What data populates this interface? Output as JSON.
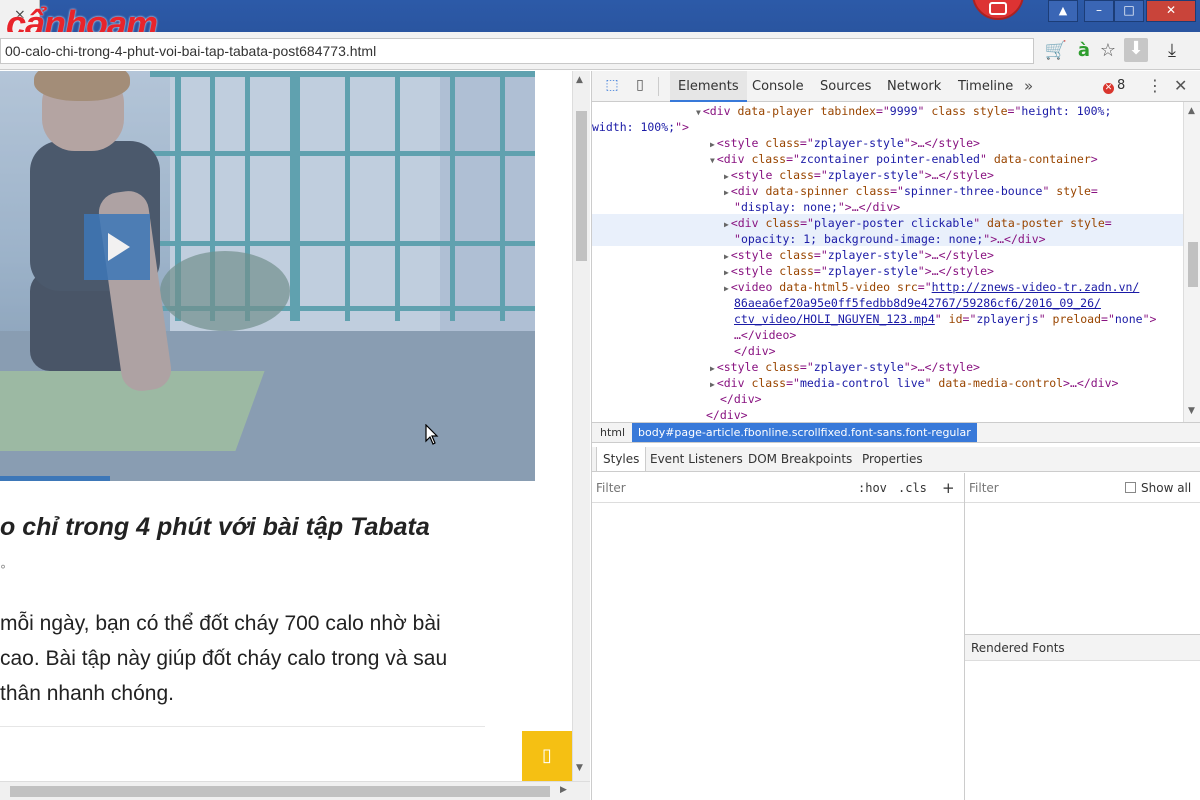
{
  "browser": {
    "tab_close": "×",
    "logo_text": "cẩnhoam",
    "url": "00-calo-chi-trong-4-phut-voi-bai-tap-tabata-post684773.html",
    "window": {
      "minimize": "–",
      "maximize": "□",
      "close": "✕",
      "user": "👤"
    },
    "toolbar": {
      "cart": "🛒",
      "a": "à",
      "star": "☆",
      "download_active": "⬇",
      "download": "⤓"
    }
  },
  "page": {
    "headline": "o chỉ trong 4 phút với bài tập Tabata",
    "degree": "°",
    "paragraph": [
      " mỗi ngày, bạn có thể đốt cháy 700 calo nhờ bài",
      "cao. Bài tập này giúp đốt cháy calo trong và sau",
      " thân nhanh chóng."
    ],
    "yellow_icon": "▯"
  },
  "devtools": {
    "tabs": [
      {
        "label": "Elements",
        "active": true
      },
      {
        "label": "Console"
      },
      {
        "label": "Sources"
      },
      {
        "label": "Network"
      },
      {
        "label": "Timeline"
      }
    ],
    "more": "»",
    "error_count": "8",
    "error_dot": "✕",
    "kebab": "⋮",
    "close": "✕",
    "breadcrumbs": [
      {
        "label": "html"
      },
      {
        "label": "body#page-article.fbonline.scrollfixed.font-sans.font-regular",
        "selected": true
      }
    ],
    "subtabs": [
      {
        "label": "Styles",
        "active": true
      },
      {
        "label": "Event Listeners"
      },
      {
        "label": "DOM Breakpoints"
      },
      {
        "label": "Properties"
      }
    ],
    "filter_placeholder": "Filter",
    "hov": ":hov",
    "cls": ".cls",
    "plus": "+",
    "right_filter_placeholder": "Filter",
    "show_all": "Show all",
    "rendered_fonts": "Rendered Fonts"
  },
  "dom_lines": [
    {
      "indent": 104,
      "tri": "▼",
      "parts": [
        [
          "tag",
          "<div "
        ],
        [
          "attr",
          "data-player "
        ],
        [
          "attr",
          "tabindex"
        ],
        [
          "tag",
          "=\""
        ],
        [
          "val",
          "9999"
        ],
        [
          "tag",
          "\" "
        ],
        [
          "attr",
          "class "
        ],
        [
          "attr",
          "style"
        ],
        [
          "tag",
          "=\""
        ],
        [
          "val",
          "height: 100%;"
        ]
      ]
    },
    {
      "indent": 104,
      "tri": "",
      "parts": [
        [
          "val",
          "width: 100%;"
        ],
        [
          "tag",
          "\">"
        ]
      ]
    },
    {
      "indent": 118,
      "tri": "▶",
      "parts": [
        [
          "tag",
          "<style "
        ],
        [
          "attr",
          "class"
        ],
        [
          "tag",
          "=\""
        ],
        [
          "val",
          "zplayer-style"
        ],
        [
          "tag",
          "\">…</style>"
        ]
      ]
    },
    {
      "indent": 118,
      "tri": "▼",
      "parts": [
        [
          "tag",
          "<div "
        ],
        [
          "attr",
          "class"
        ],
        [
          "tag",
          "=\""
        ],
        [
          "val",
          "zcontainer pointer-enabled"
        ],
        [
          "tag",
          "\" "
        ],
        [
          "attr",
          "data-container"
        ],
        [
          "tag",
          ">"
        ]
      ]
    },
    {
      "indent": 132,
      "tri": "▶",
      "parts": [
        [
          "tag",
          "<style "
        ],
        [
          "attr",
          "class"
        ],
        [
          "tag",
          "=\""
        ],
        [
          "val",
          "zplayer-style"
        ],
        [
          "tag",
          "\">…</style>"
        ]
      ]
    },
    {
      "indent": 132,
      "tri": "▶",
      "parts": [
        [
          "tag",
          "<div "
        ],
        [
          "attr",
          "data-spinner "
        ],
        [
          "attr",
          "class"
        ],
        [
          "tag",
          "=\""
        ],
        [
          "val",
          "spinner-three-bounce"
        ],
        [
          "tag",
          "\" "
        ],
        [
          "attr",
          "style"
        ],
        [
          "tag",
          "="
        ]
      ]
    },
    {
      "indent": 132,
      "tri": "",
      "parts": [
        [
          "tag",
          "\""
        ],
        [
          "val",
          "display: none;"
        ],
        [
          "tag",
          "\">…</div>"
        ]
      ]
    },
    {
      "indent": 132,
      "tri": "▶",
      "parts": [
        [
          "tag",
          "<div "
        ],
        [
          "attr",
          "class"
        ],
        [
          "tag",
          "=\""
        ],
        [
          "val",
          "player-poster clickable"
        ],
        [
          "tag",
          "\" "
        ],
        [
          "attr",
          "data-poster "
        ],
        [
          "attr",
          "style"
        ],
        [
          "tag",
          "="
        ]
      ]
    },
    {
      "indent": 132,
      "tri": "",
      "parts": [
        [
          "tag",
          "\""
        ],
        [
          "val",
          "opacity: 1; background-image: none;"
        ],
        [
          "tag",
          "\">…</div>"
        ]
      ]
    },
    {
      "indent": 132,
      "tri": "▶",
      "parts": [
        [
          "tag",
          "<style "
        ],
        [
          "attr",
          "class"
        ],
        [
          "tag",
          "=\""
        ],
        [
          "val",
          "zplayer-style"
        ],
        [
          "tag",
          "\">…</style>"
        ]
      ]
    },
    {
      "indent": 132,
      "tri": "▶",
      "parts": [
        [
          "tag",
          "<style "
        ],
        [
          "attr",
          "class"
        ],
        [
          "tag",
          "=\""
        ],
        [
          "val",
          "zplayer-style"
        ],
        [
          "tag",
          "\">…</style>"
        ]
      ]
    },
    {
      "indent": 132,
      "tri": "▶",
      "parts": [
        [
          "tag",
          "<video "
        ],
        [
          "attr",
          "data-html5-video "
        ],
        [
          "attr",
          "src"
        ],
        [
          "tag",
          "=\""
        ],
        [
          "lnk",
          "http://znews-video-tr.zadn.vn/"
        ]
      ]
    },
    {
      "indent": 132,
      "tri": "",
      "parts": [
        [
          "lnk",
          "86aea6ef20a95e0ff5fedbb8d9e42767/59286cf6/2016_09_26/"
        ]
      ]
    },
    {
      "indent": 132,
      "tri": "",
      "parts": [
        [
          "lnk",
          "ctv_video/HOLI_NGUYEN_123.mp4"
        ],
        [
          "tag",
          "\" "
        ],
        [
          "attr",
          "id"
        ],
        [
          "tag",
          "=\""
        ],
        [
          "val",
          "zplayerjs"
        ],
        [
          "tag",
          "\" "
        ],
        [
          "attr",
          "preload"
        ],
        [
          "tag",
          "=\""
        ],
        [
          "val",
          "none"
        ],
        [
          "tag",
          "\">"
        ]
      ]
    },
    {
      "indent": 132,
      "tri": "",
      "parts": [
        [
          "tag",
          "…</video>"
        ]
      ]
    },
    {
      "indent": 132,
      "tri": "",
      "parts": [
        [
          "tag",
          "</div>"
        ]
      ]
    },
    {
      "indent": 118,
      "tri": "▶",
      "parts": [
        [
          "tag",
          "<style "
        ],
        [
          "attr",
          "class"
        ],
        [
          "tag",
          "=\""
        ],
        [
          "val",
          "zplayer-style"
        ],
        [
          "tag",
          "\">…</style>"
        ]
      ]
    },
    {
      "indent": 118,
      "tri": "▶",
      "parts": [
        [
          "tag",
          "<div "
        ],
        [
          "attr",
          "class"
        ],
        [
          "tag",
          "=\""
        ],
        [
          "val",
          "media-control live"
        ],
        [
          "tag",
          "\" "
        ],
        [
          "attr",
          "data-media-control"
        ],
        [
          "tag",
          ">…</div>"
        ]
      ]
    },
    {
      "indent": 118,
      "tri": "",
      "parts": [
        [
          "tag",
          "</div>"
        ]
      ]
    },
    {
      "indent": 104,
      "tri": "",
      "parts": [
        [
          "tag",
          "</div>"
        ]
      ]
    }
  ]
}
